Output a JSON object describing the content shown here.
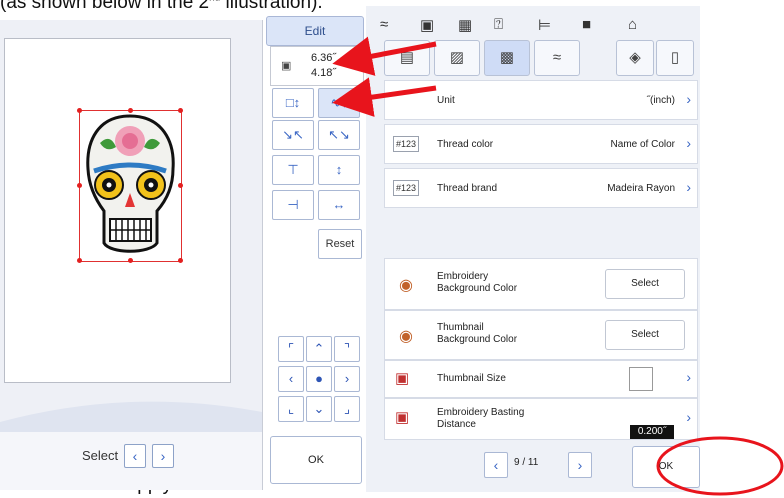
{
  "captions": {
    "top": "(as shown below in the 2",
    "top_tail": "illustration).",
    "bottom": "Click on OK to apply"
  },
  "left": {
    "select_label": "Select"
  },
  "edit": {
    "tab_label": "Edit",
    "width": "6.36˝",
    "height": "4.18˝",
    "reset_label": "Reset",
    "ok_label": "OK"
  },
  "settings": {
    "rows": [
      {
        "label": "Unit",
        "value": "˝(inch)"
      },
      {
        "label": "Thread color",
        "value": "Name of Color",
        "icon": "#123 ABC"
      },
      {
        "label": "Thread brand",
        "value": "Madeira Rayon",
        "icon": "#123"
      },
      {
        "label": "Embroidery\nBackground Color",
        "button": "Select"
      },
      {
        "label": "Thumbnail\nBackground Color",
        "button": "Select"
      },
      {
        "label": "Thumbnail Size"
      },
      {
        "label": "Embroidery Basting\nDistance",
        "value": "0.200˝"
      }
    ],
    "pager": "9 / 11",
    "ok_label": "OK"
  },
  "colors": {
    "accent": "#3a66c4",
    "annotation": "#e8141c",
    "panel_bg": "#eef1f7"
  }
}
